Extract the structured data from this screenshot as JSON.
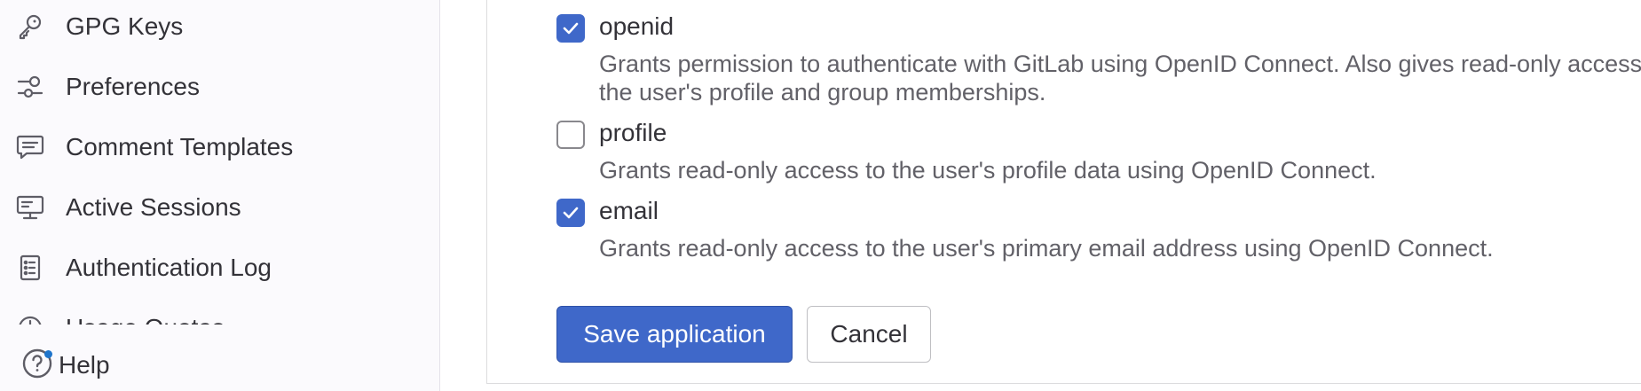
{
  "sidebar": {
    "items": [
      {
        "label": "GPG Keys",
        "icon": "key-icon"
      },
      {
        "label": "Preferences",
        "icon": "preferences-icon"
      },
      {
        "label": "Comment Templates",
        "icon": "comment-icon"
      },
      {
        "label": "Active Sessions",
        "icon": "monitor-icon"
      },
      {
        "label": "Authentication Log",
        "icon": "log-icon"
      },
      {
        "label": "Usage Quotas",
        "icon": "gauge-icon"
      }
    ],
    "help_label": "Help"
  },
  "main": {
    "scopes": [
      {
        "name": "openid",
        "checked": true,
        "description": "Grants permission to authenticate with GitLab using OpenID Connect. Also gives read-only access to the user's profile and group memberships."
      },
      {
        "name": "profile",
        "checked": false,
        "description": "Grants read-only access to the user's profile data using OpenID Connect."
      },
      {
        "name": "email",
        "checked": true,
        "description": "Grants read-only access to the user's primary email address using OpenID Connect."
      }
    ],
    "save_label": "Save application",
    "cancel_label": "Cancel"
  },
  "colors": {
    "accent": "#3f68c9",
    "text": "#333238",
    "muted": "#626168",
    "sidebar_bg": "#fbfafd",
    "notification_dot": "#1f75cb"
  }
}
